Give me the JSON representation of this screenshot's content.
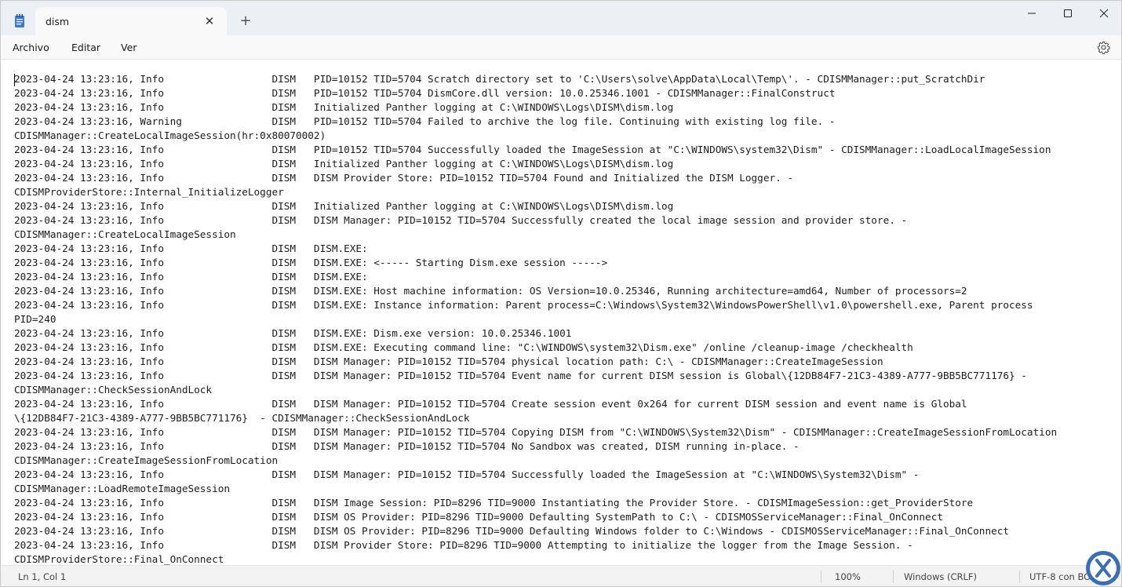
{
  "titlebar": {
    "tab_title": "dism",
    "new_tab": "+"
  },
  "menu": {
    "items": [
      "Archivo",
      "Editar",
      "Ver"
    ]
  },
  "editor": {
    "lines": [
      "2023-04-24 13:23:16, Info                  DISM   PID=10152 TID=5704 Scratch directory set to 'C:\\Users\\solve\\AppData\\Local\\Temp\\'. - CDISMManager::put_ScratchDir",
      "2023-04-24 13:23:16, Info                  DISM   PID=10152 TID=5704 DismCore.dll version: 10.0.25346.1001 - CDISMManager::FinalConstruct",
      "2023-04-24 13:23:16, Info                  DISM   Initialized Panther logging at C:\\WINDOWS\\Logs\\DISM\\dism.log",
      "2023-04-24 13:23:16, Warning               DISM   PID=10152 TID=5704 Failed to archive the log file. Continuing with existing log file. -",
      "CDISMManager::CreateLocalImageSession(hr:0x80070002)",
      "2023-04-24 13:23:16, Info                  DISM   PID=10152 TID=5704 Successfully loaded the ImageSession at \"C:\\WINDOWS\\system32\\Dism\" - CDISMManager::LoadLocalImageSession",
      "2023-04-24 13:23:16, Info                  DISM   Initialized Panther logging at C:\\WINDOWS\\Logs\\DISM\\dism.log",
      "2023-04-24 13:23:16, Info                  DISM   DISM Provider Store: PID=10152 TID=5704 Found and Initialized the DISM Logger. -",
      "CDISMProviderStore::Internal_InitializeLogger",
      "2023-04-24 13:23:16, Info                  DISM   Initialized Panther logging at C:\\WINDOWS\\Logs\\DISM\\dism.log",
      "2023-04-24 13:23:16, Info                  DISM   DISM Manager: PID=10152 TID=5704 Successfully created the local image session and provider store. -",
      "CDISMManager::CreateLocalImageSession",
      "2023-04-24 13:23:16, Info                  DISM   DISM.EXE:",
      "2023-04-24 13:23:16, Info                  DISM   DISM.EXE: <----- Starting Dism.exe session ----->",
      "2023-04-24 13:23:16, Info                  DISM   DISM.EXE:",
      "2023-04-24 13:23:16, Info                  DISM   DISM.EXE: Host machine information: OS Version=10.0.25346, Running architecture=amd64, Number of processors=2",
      "2023-04-24 13:23:16, Info                  DISM   DISM.EXE: Instance information: Parent process=C:\\Windows\\System32\\WindowsPowerShell\\v1.0\\powershell.exe, Parent process",
      "PID=240",
      "2023-04-24 13:23:16, Info                  DISM   DISM.EXE: Dism.exe version: 10.0.25346.1001",
      "2023-04-24 13:23:16, Info                  DISM   DISM.EXE: Executing command line: \"C:\\WINDOWS\\system32\\Dism.exe\" /online /cleanup-image /checkhealth",
      "2023-04-24 13:23:16, Info                  DISM   DISM Manager: PID=10152 TID=5704 physical location path: C:\\ - CDISMManager::CreateImageSession",
      "2023-04-24 13:23:16, Info                  DISM   DISM Manager: PID=10152 TID=5704 Event name for current DISM session is Global\\{12DB84F7-21C3-4389-A777-9BB5BC771176} -",
      "CDISMManager::CheckSessionAndLock",
      "2023-04-24 13:23:16, Info                  DISM   DISM Manager: PID=10152 TID=5704 Create session event 0x264 for current DISM session and event name is Global",
      "\\{12DB84F7-21C3-4389-A777-9BB5BC771176}  - CDISMManager::CheckSessionAndLock",
      "2023-04-24 13:23:16, Info                  DISM   DISM Manager: PID=10152 TID=5704 Copying DISM from \"C:\\WINDOWS\\System32\\Dism\" - CDISMManager::CreateImageSessionFromLocation",
      "2023-04-24 13:23:16, Info                  DISM   DISM Manager: PID=10152 TID=5704 No Sandbox was created, DISM running in-place. -",
      "CDISMManager::CreateImageSessionFromLocation",
      "2023-04-24 13:23:16, Info                  DISM   DISM Manager: PID=10152 TID=5704 Successfully loaded the ImageSession at \"C:\\WINDOWS\\System32\\Dism\" -",
      "CDISMManager::LoadRemoteImageSession",
      "2023-04-24 13:23:16, Info                  DISM   DISM Image Session: PID=8296 TID=9000 Instantiating the Provider Store. - CDISMImageSession::get_ProviderStore",
      "2023-04-24 13:23:16, Info                  DISM   DISM OS Provider: PID=8296 TID=9000 Defaulting SystemPath to C:\\ - CDISMOSServiceManager::Final_OnConnect",
      "2023-04-24 13:23:16, Info                  DISM   DISM OS Provider: PID=8296 TID=9000 Defaulting Windows folder to C:\\Windows - CDISMOSServiceManager::Final_OnConnect",
      "2023-04-24 13:23:16, Info                  DISM   DISM Provider Store: PID=8296 TID=9000 Attempting to initialize the logger from the Image Session. -",
      "CDISMProviderStore::Final_OnConnect"
    ]
  },
  "status": {
    "position": "Ln 1, Col 1",
    "zoom": "100%",
    "line_ending": "Windows (CRLF)",
    "encoding": "UTF-8 con BOM"
  },
  "colors": {
    "accent": "#2f5fa8",
    "logo": "#3a6fb6"
  }
}
